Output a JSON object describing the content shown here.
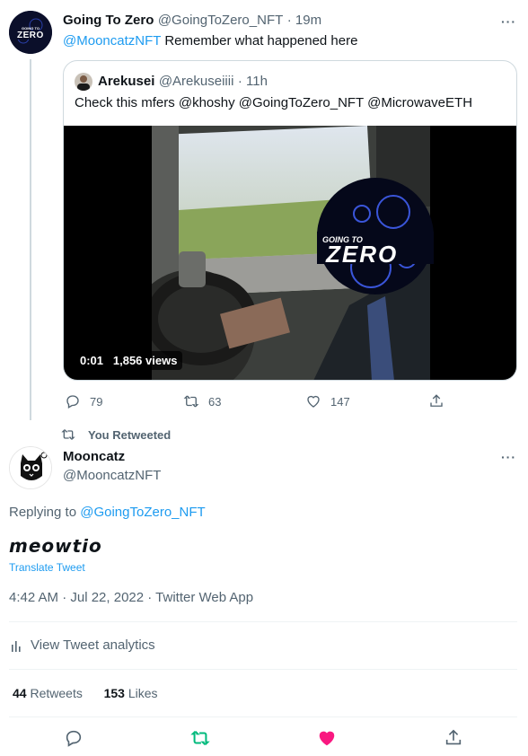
{
  "reply_tweet": {
    "display_name": "Going To Zero",
    "handle": "@GoingToZero_NFT",
    "time": "· 19m",
    "text_mention": "@MooncatzNFT",
    "text": " Remember what happened here",
    "avatar_text_top": "GOING TO",
    "avatar_text": "ZERO"
  },
  "quoted_tweet": {
    "display_name": "Arekusei",
    "handle": "@Arekuseiiii",
    "time": "· 11h",
    "text": "Check this mfers @khoshy @GoingToZero_NFT @MicrowaveETH",
    "video": {
      "time": "0:01",
      "views": "1,856 views",
      "logo_top": "GOING TO",
      "logo_main": "ZERO"
    }
  },
  "reply_actions": {
    "replies": "79",
    "retweets": "63",
    "likes": "147"
  },
  "retweet_context": "You Retweeted",
  "main_tweet": {
    "display_name": "Mooncatz",
    "handle": "@MooncatzNFT",
    "replying_prefix": "Replying to ",
    "replying_handle": "@GoingToZero_NFT",
    "text": "𝙢𝙚𝙤𝙬𝙩𝙞𝙤",
    "translate": "Translate Tweet",
    "timestamp": "4:42 AM · Jul 22, 2022 · Twitter Web App",
    "analytics": "View Tweet analytics",
    "retweets_count": "44",
    "retweets_label": "Retweets",
    "likes_count": "153",
    "likes_label": "Likes"
  },
  "colors": {
    "accent": "#1d9bf0",
    "retweet_green": "#00ba7c",
    "like_pink": "#f91880",
    "secondary_text": "#536471"
  }
}
